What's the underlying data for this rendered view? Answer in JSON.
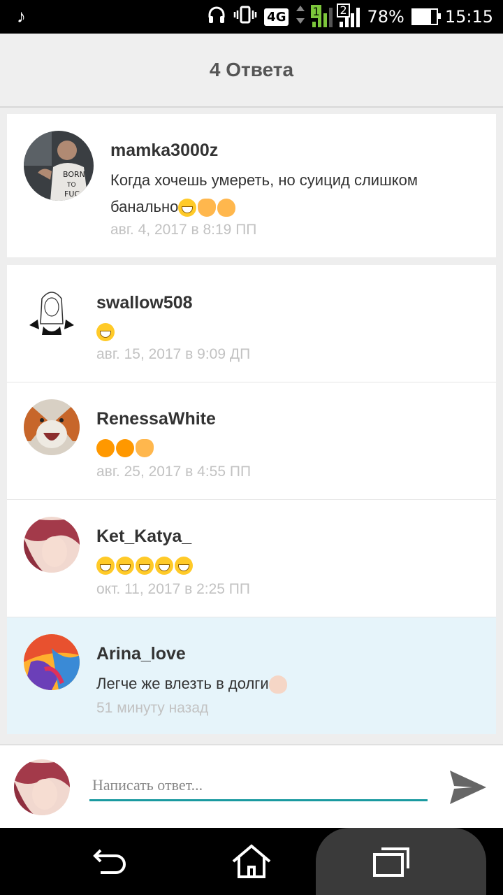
{
  "status_bar": {
    "network": "4G",
    "sim1": "1",
    "sim2": "2",
    "battery": "78%",
    "time": "15:15"
  },
  "header": {
    "title": "4 Ответа"
  },
  "post": {
    "username": "mamka3000z",
    "text": "Когда хочешь умереть, но суицид слишком банально",
    "time": "авг. 4, 2017 в 8:19 ПП"
  },
  "replies": [
    {
      "username": "swallow508",
      "text": "",
      "time": "авг. 15, 2017 в 9:09 ДП"
    },
    {
      "username": "RenessaWhite",
      "text": "",
      "time": "авг. 25, 2017 в 4:55 ПП"
    },
    {
      "username": "Ket_Katya_",
      "text": "",
      "time": "окт. 11, 2017 в 2:25 ПП"
    },
    {
      "username": "Arina_love",
      "text": "Легче же влезть в долги",
      "time": "51 минуту назад"
    }
  ],
  "composer": {
    "placeholder": "Написать ответ..."
  },
  "colors": {
    "accent": "#1a9aa0",
    "highlight": "#e6f4fa"
  }
}
